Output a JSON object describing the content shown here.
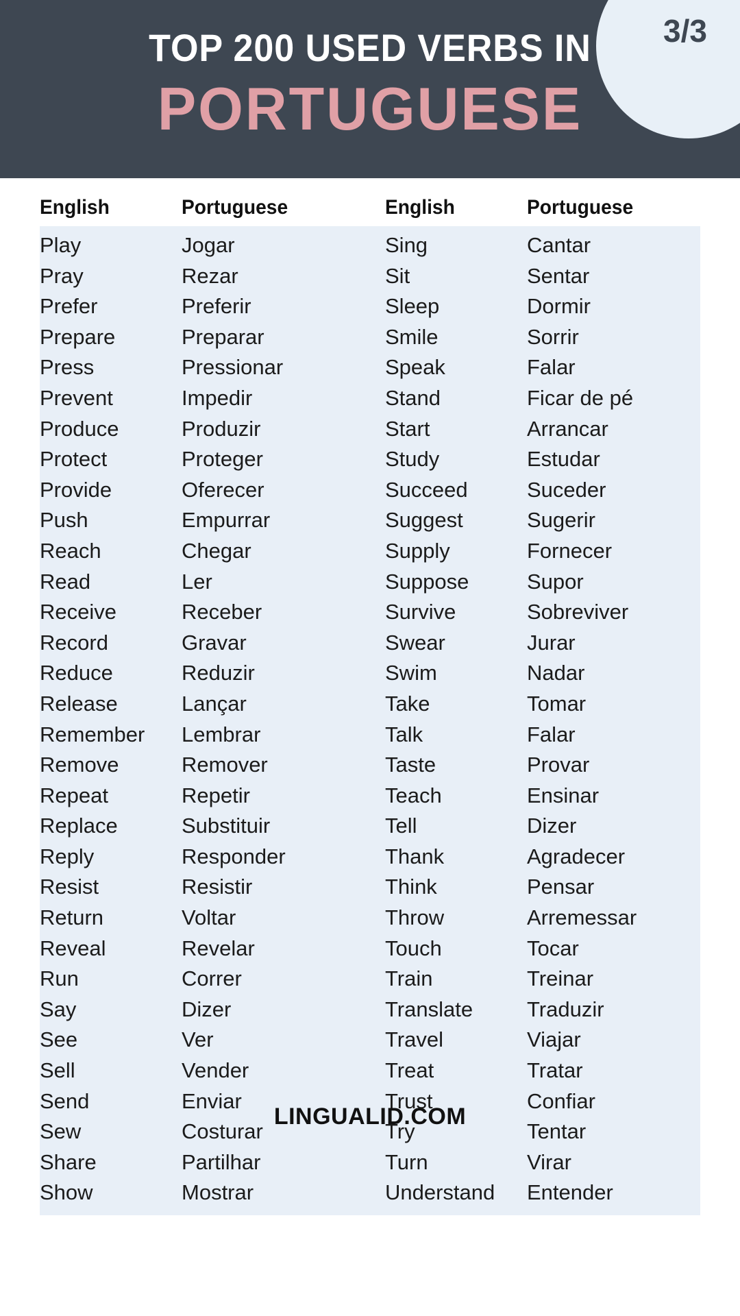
{
  "header": {
    "title_line1": "TOP 200 USED VERBS IN",
    "title_line2": "PORTUGUESE",
    "page_badge": "3/3",
    "bg_color": "#3e4752",
    "accent_color": "#e0a0a6",
    "badge_bg_color": "#e8f0f7"
  },
  "table": {
    "row_bg_color": "#e8eff7",
    "headers": [
      "English",
      "Portuguese",
      "English",
      "Portuguese"
    ],
    "left": [
      {
        "english": "Play",
        "portuguese": "Jogar"
      },
      {
        "english": "Pray",
        "portuguese": "Rezar"
      },
      {
        "english": "Prefer",
        "portuguese": "Preferir"
      },
      {
        "english": "Prepare",
        "portuguese": "Preparar"
      },
      {
        "english": "Press",
        "portuguese": "Pressionar"
      },
      {
        "english": "Prevent",
        "portuguese": "Impedir"
      },
      {
        "english": "Produce",
        "portuguese": "Produzir"
      },
      {
        "english": "Protect",
        "portuguese": "Proteger"
      },
      {
        "english": "Provide",
        "portuguese": "Oferecer"
      },
      {
        "english": "Push",
        "portuguese": "Empurrar"
      },
      {
        "english": "Reach",
        "portuguese": "Chegar"
      },
      {
        "english": "Read",
        "portuguese": "Ler"
      },
      {
        "english": "Receive",
        "portuguese": "Receber"
      },
      {
        "english": "Record",
        "portuguese": "Gravar"
      },
      {
        "english": "Reduce",
        "portuguese": "Reduzir"
      },
      {
        "english": "Release",
        "portuguese": "Lançar"
      },
      {
        "english": "Remember",
        "portuguese": "Lembrar"
      },
      {
        "english": "Remove",
        "portuguese": "Remover"
      },
      {
        "english": "Repeat",
        "portuguese": "Repetir"
      },
      {
        "english": "Replace",
        "portuguese": "Substituir"
      },
      {
        "english": "Reply",
        "portuguese": "Responder"
      },
      {
        "english": "Resist",
        "portuguese": "Resistir"
      },
      {
        "english": "Return",
        "portuguese": "Voltar"
      },
      {
        "english": "Reveal",
        "portuguese": "Revelar"
      },
      {
        "english": "Run",
        "portuguese": "Correr"
      },
      {
        "english": "Say",
        "portuguese": "Dizer"
      },
      {
        "english": "See",
        "portuguese": "Ver"
      },
      {
        "english": "Sell",
        "portuguese": "Vender"
      },
      {
        "english": "Send",
        "portuguese": "Enviar"
      },
      {
        "english": "Sew",
        "portuguese": "Costurar"
      },
      {
        "english": "Share",
        "portuguese": "Partilhar"
      },
      {
        "english": "Show",
        "portuguese": "Mostrar"
      }
    ],
    "right": [
      {
        "english": "Sing",
        "portuguese": "Cantar"
      },
      {
        "english": "Sit",
        "portuguese": "Sentar"
      },
      {
        "english": "Sleep",
        "portuguese": "Dormir"
      },
      {
        "english": "Smile",
        "portuguese": "Sorrir"
      },
      {
        "english": "Speak",
        "portuguese": "Falar"
      },
      {
        "english": "Stand",
        "portuguese": "Ficar de pé"
      },
      {
        "english": "Start",
        "portuguese": "Arrancar"
      },
      {
        "english": "Study",
        "portuguese": "Estudar"
      },
      {
        "english": "Succeed",
        "portuguese": "Suceder"
      },
      {
        "english": "Suggest",
        "portuguese": "Sugerir"
      },
      {
        "english": "Supply",
        "portuguese": "Fornecer"
      },
      {
        "english": "Suppose",
        "portuguese": "Supor"
      },
      {
        "english": "Survive",
        "portuguese": "Sobreviver"
      },
      {
        "english": "Swear",
        "portuguese": "Jurar"
      },
      {
        "english": "Swim",
        "portuguese": "Nadar"
      },
      {
        "english": "Take",
        "portuguese": "Tomar"
      },
      {
        "english": "Talk",
        "portuguese": "Falar"
      },
      {
        "english": "Taste",
        "portuguese": "Provar"
      },
      {
        "english": "Teach",
        "portuguese": "Ensinar"
      },
      {
        "english": "Tell",
        "portuguese": "Dizer"
      },
      {
        "english": "Thank",
        "portuguese": "Agradecer"
      },
      {
        "english": "Think",
        "portuguese": "Pensar"
      },
      {
        "english": "Throw",
        "portuguese": "Arremessar"
      },
      {
        "english": "Touch",
        "portuguese": "Tocar"
      },
      {
        "english": "Train",
        "portuguese": "Treinar"
      },
      {
        "english": "Translate",
        "portuguese": "Traduzir"
      },
      {
        "english": "Travel",
        "portuguese": "Viajar"
      },
      {
        "english": "Treat",
        "portuguese": "Tratar"
      },
      {
        "english": "Trust",
        "portuguese": "Confiar"
      },
      {
        "english": "Try",
        "portuguese": "Tentar"
      },
      {
        "english": "Turn",
        "portuguese": "Virar"
      },
      {
        "english": "Understand",
        "portuguese": "Entender"
      }
    ]
  },
  "footer": {
    "brand": "LINGUALID.COM"
  }
}
